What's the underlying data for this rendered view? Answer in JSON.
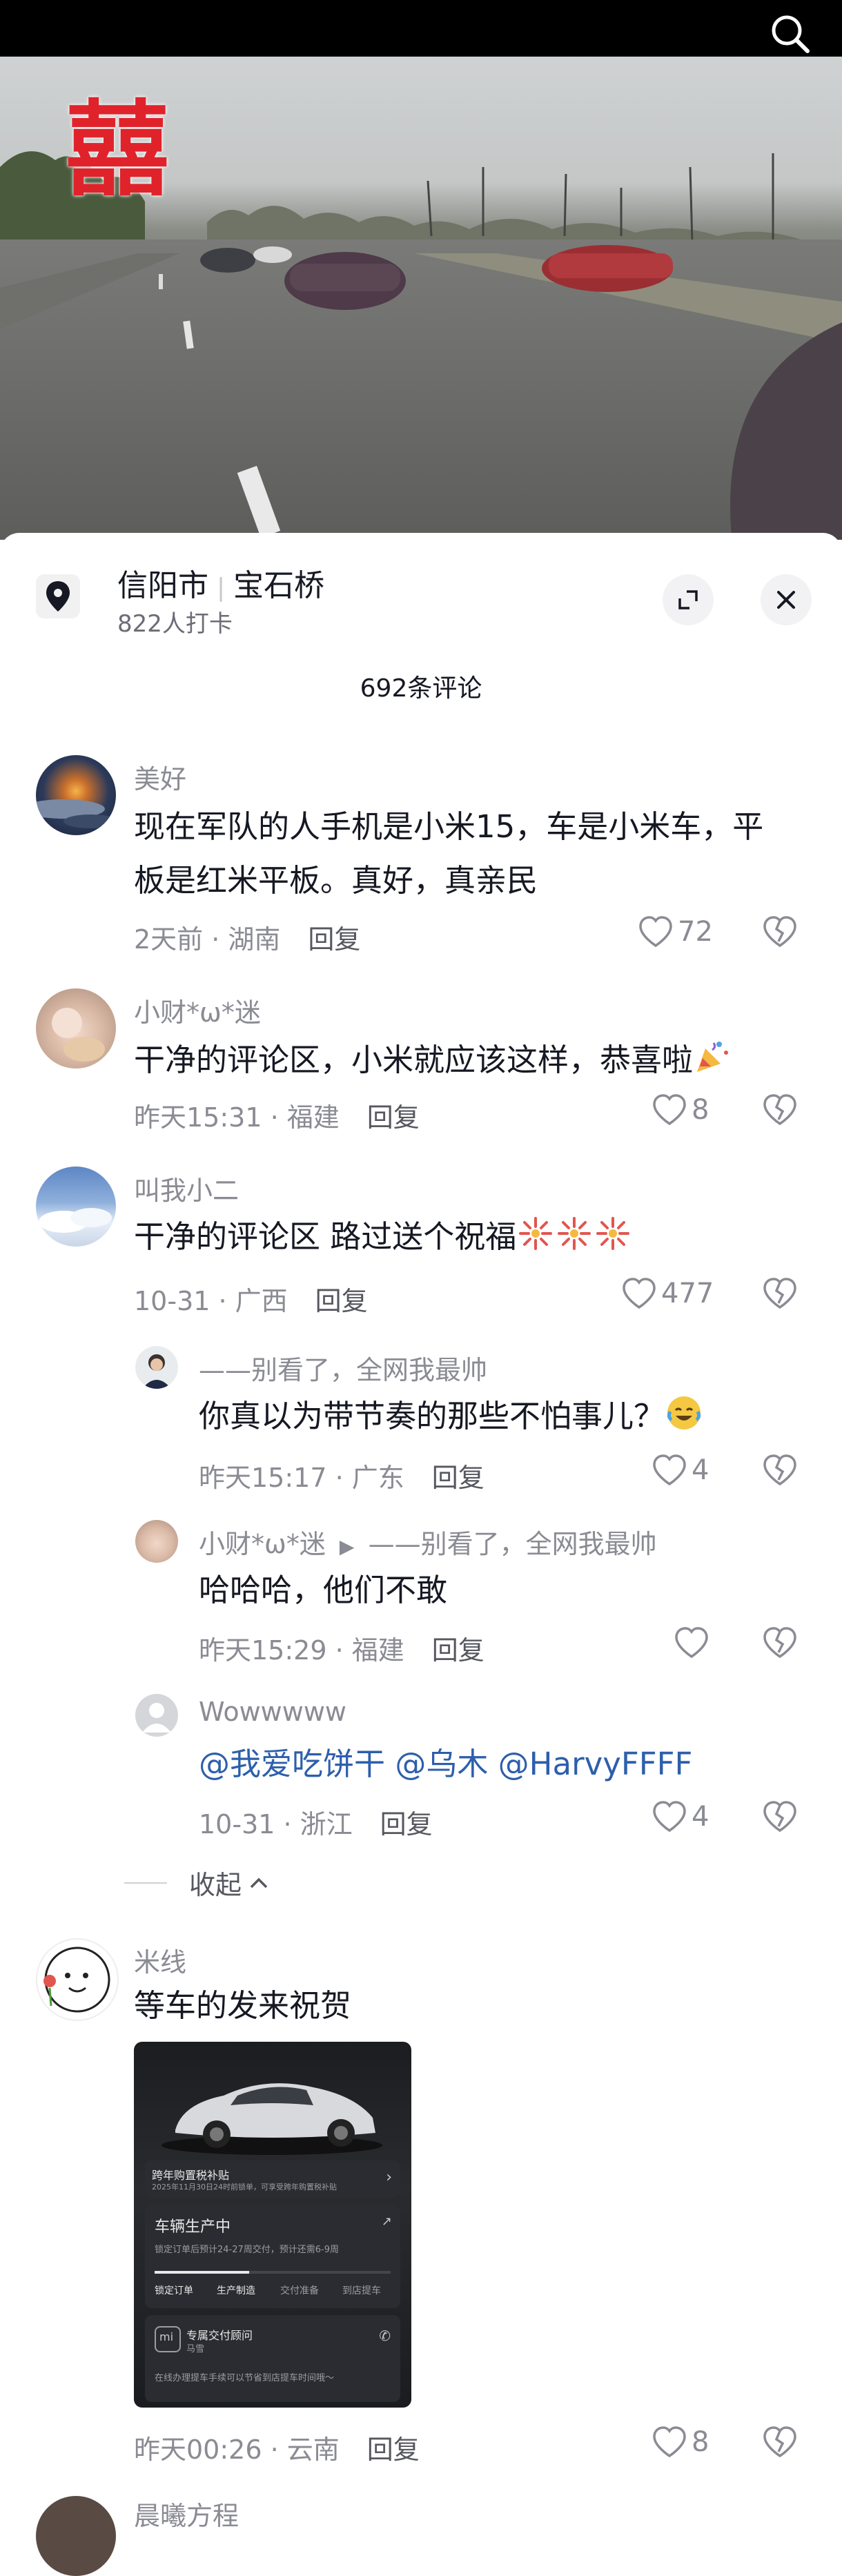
{
  "location": {
    "city": "信阳市",
    "place": "宝石桥",
    "checkins": "822人打卡"
  },
  "video": {
    "overlay_char": "囍"
  },
  "comments_count": "692条评论",
  "comments": [
    {
      "username": "美好",
      "text_line1": "现在军队的人手机是小米15，车是小米车，平",
      "text_line2": "板是红米平板。真好，真亲民",
      "meta": "2天前 · 湖南",
      "reply_label": "回复",
      "likes": "72"
    },
    {
      "username": "小财*ω*迷",
      "text": "干净的评论区，小米就应该这样，恭喜啦",
      "meta": "昨天15:31 · 福建",
      "reply_label": "回复",
      "likes": "8"
    },
    {
      "username": "叫我小二",
      "text": "干净的评论区  路过送个祝福",
      "meta": "10-31 · 广西",
      "reply_label": "回复",
      "likes": "477"
    }
  ],
  "replies": [
    {
      "username": "——别看了，全网我最帅",
      "text": "你真以为带节奏的那些不怕事儿？",
      "meta": "昨天15:17 · 广东",
      "reply_label": "回复",
      "likes": "4"
    },
    {
      "username": "小财*ω*迷",
      "reply_to": "——别看了，全网我最帅",
      "text": "哈哈哈，他们不敢",
      "meta": "昨天15:29 · 福建",
      "reply_label": "回复",
      "likes": ""
    },
    {
      "username": "Wowwwww",
      "mention1": "@我爱吃饼干",
      "mention2": "@乌木",
      "mention3": "@HarvyFFFF",
      "meta": "10-31 · 浙江",
      "reply_label": "回复",
      "likes": "4"
    }
  ],
  "collapse_label": "收起",
  "comment4": {
    "username": "米线",
    "text": "等车的发来祝贺",
    "meta": "昨天00:26 · 云南",
    "reply_label": "回复",
    "likes": "8",
    "image": {
      "subsidy_title": "跨年购置税补贴",
      "subsidy_desc": "2025年11月30日24时前锁单，可享受跨年购置税补贴",
      "production_title": "车辆生产中",
      "production_desc": "锁定订单后预计24-27周交付，预计还需6-9周",
      "steps": [
        "锁定订单",
        "生产制造",
        "交付准备",
        "到店提车"
      ],
      "advisor_title": "专属交付顾问",
      "advisor_name": "马雪",
      "advisor_desc": "在线办理提车手续可以节省到店提车时间哦～"
    }
  },
  "next_user": {
    "username": "晨曦方程"
  },
  "colors": {
    "mention": "#2d5fab",
    "meta_gray": "#8a8b93",
    "text": "#161823"
  }
}
